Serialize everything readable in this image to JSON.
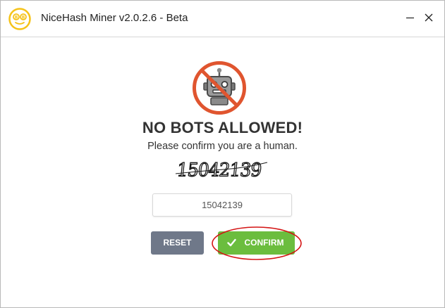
{
  "window": {
    "title": "NiceHash Miner v2.0.2.6 - Beta",
    "minimize_glyph": "—",
    "close_glyph": "✕"
  },
  "icons": {
    "app": "nicehash-logo-icon",
    "no_bots": "no-robot-icon",
    "check": "check-icon"
  },
  "captcha": {
    "heading": "NO BOTS ALLOWED!",
    "subheading": "Please confirm you are a human.",
    "image_text": "15042139",
    "input_value": "15042139"
  },
  "buttons": {
    "reset_label": "RESET",
    "confirm_label": "CONFIRM"
  },
  "colors": {
    "reset_bg": "#6f7889",
    "confirm_bg": "#6bbd3e",
    "no_bot_ring": "#e0552f",
    "logo_yellow": "#f5c319",
    "annotation_red": "#d41414"
  }
}
